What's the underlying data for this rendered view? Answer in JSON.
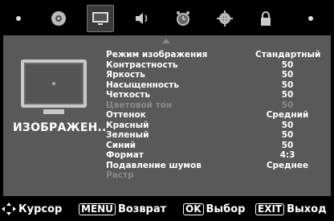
{
  "tabs": [
    {
      "icon": "dot-icon",
      "label": ""
    },
    {
      "icon": "disc-icon",
      "label": ""
    },
    {
      "icon": "picture-icon",
      "label": "",
      "active": true
    },
    {
      "icon": "speaker-icon",
      "label": ""
    },
    {
      "icon": "clock-icon",
      "label": ""
    },
    {
      "icon": "gear-icon",
      "label": ""
    },
    {
      "icon": "lock-icon",
      "label": ""
    },
    {
      "icon": "dot-icon",
      "label": ""
    }
  ],
  "category_label": "ИЗОБРАЖЕН..",
  "settings": [
    {
      "label": "Режим изображения",
      "value": "Стандартный"
    },
    {
      "label": "Контрастность",
      "value": "50"
    },
    {
      "label": "Яркость",
      "value": "50"
    },
    {
      "label": "Насыщенность",
      "value": "50"
    },
    {
      "label": "Четкость",
      "value": "50"
    },
    {
      "label": "Цветовой тон",
      "value": "50",
      "disabled": true
    },
    {
      "label": "Оттенок",
      "value": "Средний"
    },
    {
      "label": "Красный",
      "value": "50"
    },
    {
      "label": "Зеленый",
      "value": "50"
    },
    {
      "label": "Синий",
      "value": "50"
    },
    {
      "label": "Формат",
      "value": "4:3"
    },
    {
      "label": "Подавление шумов",
      "value": "Среднее"
    },
    {
      "label": "Растр",
      "value": "",
      "disabled": true
    }
  ],
  "footer": {
    "cursor_label": "Курсор",
    "menu_key": "MENU",
    "menu_label": "Возврат",
    "ok_key": "OK",
    "ok_label": "Выбор",
    "exit_key": "EXIT",
    "exit_label": "Выход"
  },
  "colors": {
    "panel": "#595959",
    "background": "#000000",
    "disabled_text": "#8a8a8a"
  }
}
